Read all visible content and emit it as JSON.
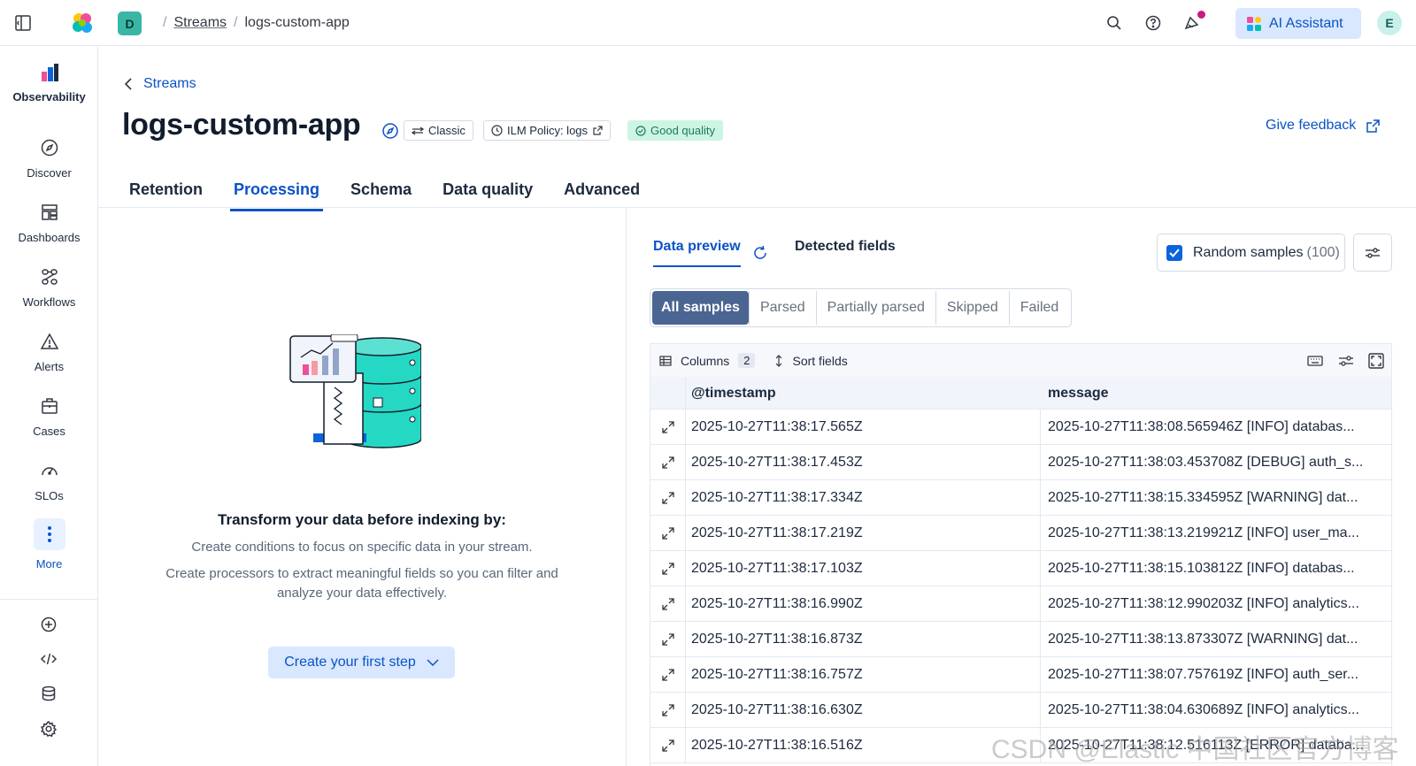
{
  "topbar": {
    "space_initial": "D",
    "breadcrumbs": [
      "Streams",
      "logs-custom-app"
    ],
    "ai_assistant_label": "AI Assistant",
    "avatar_initial": "E"
  },
  "nav": {
    "solution_label": "Observability",
    "items": [
      {
        "label": "Discover",
        "icon": "compass-icon"
      },
      {
        "label": "Dashboards",
        "icon": "dashboard-icon"
      },
      {
        "label": "Workflows",
        "icon": "workflow-icon"
      },
      {
        "label": "Alerts",
        "icon": "warning-icon"
      },
      {
        "label": "Cases",
        "icon": "briefcase-icon"
      },
      {
        "label": "SLOs",
        "icon": "gauge-icon"
      }
    ],
    "more_label": "More"
  },
  "header": {
    "back_label": "Streams",
    "title": "logs-custom-app",
    "badges": {
      "classic": "Classic",
      "ilm": "ILM Policy: logs",
      "quality": "Good quality"
    },
    "feedback_label": "Give feedback"
  },
  "tabs": [
    "Retention",
    "Processing",
    "Schema",
    "Data quality",
    "Advanced"
  ],
  "active_tab": "Processing",
  "empty_state": {
    "title": "Transform your data before indexing by:",
    "line1": "Create conditions to focus on specific data in your stream.",
    "line2": "Create processors to extract meaningful fields so you can filter and analyze your data effectively.",
    "cta_label": "Create your first step"
  },
  "preview": {
    "tab_preview": "Data preview",
    "tab_fields": "Detected fields",
    "random_samples_label": "Random samples",
    "random_samples_count": "(100)",
    "filters": [
      "All samples",
      "Parsed",
      "Partially parsed",
      "Skipped",
      "Failed"
    ],
    "active_filter": "All samples",
    "columns_label": "Columns",
    "columns_count": "2",
    "sort_label": "Sort fields",
    "headers": [
      "@timestamp",
      "message"
    ],
    "rows": [
      {
        "ts": "2025-10-27T11:38:17.565Z",
        "msg": "2025-10-27T11:38:08.565946Z [INFO] databas..."
      },
      {
        "ts": "2025-10-27T11:38:17.453Z",
        "msg": "2025-10-27T11:38:03.453708Z [DEBUG] auth_s..."
      },
      {
        "ts": "2025-10-27T11:38:17.334Z",
        "msg": "2025-10-27T11:38:15.334595Z [WARNING] dat..."
      },
      {
        "ts": "2025-10-27T11:38:17.219Z",
        "msg": "2025-10-27T11:38:13.219921Z [INFO] user_ma..."
      },
      {
        "ts": "2025-10-27T11:38:17.103Z",
        "msg": "2025-10-27T11:38:15.103812Z [INFO] databas..."
      },
      {
        "ts": "2025-10-27T11:38:16.990Z",
        "msg": "2025-10-27T11:38:12.990203Z [INFO] analytics..."
      },
      {
        "ts": "2025-10-27T11:38:16.873Z",
        "msg": "2025-10-27T11:38:13.873307Z [WARNING] dat..."
      },
      {
        "ts": "2025-10-27T11:38:16.757Z",
        "msg": "2025-10-27T11:38:07.757619Z [INFO] auth_ser..."
      },
      {
        "ts": "2025-10-27T11:38:16.630Z",
        "msg": "2025-10-27T11:38:04.630689Z [INFO] analytics..."
      },
      {
        "ts": "2025-10-27T11:38:16.516Z",
        "msg": "2025-10-27T11:38:12.516113Z [ERROR] databa..."
      }
    ]
  },
  "watermark": "CSDN @Elastic 中国社区官方博客",
  "colors": {
    "accent": "#0b52c6",
    "active_filter": "#4a6591",
    "good_quality": "#cdf5e4"
  }
}
